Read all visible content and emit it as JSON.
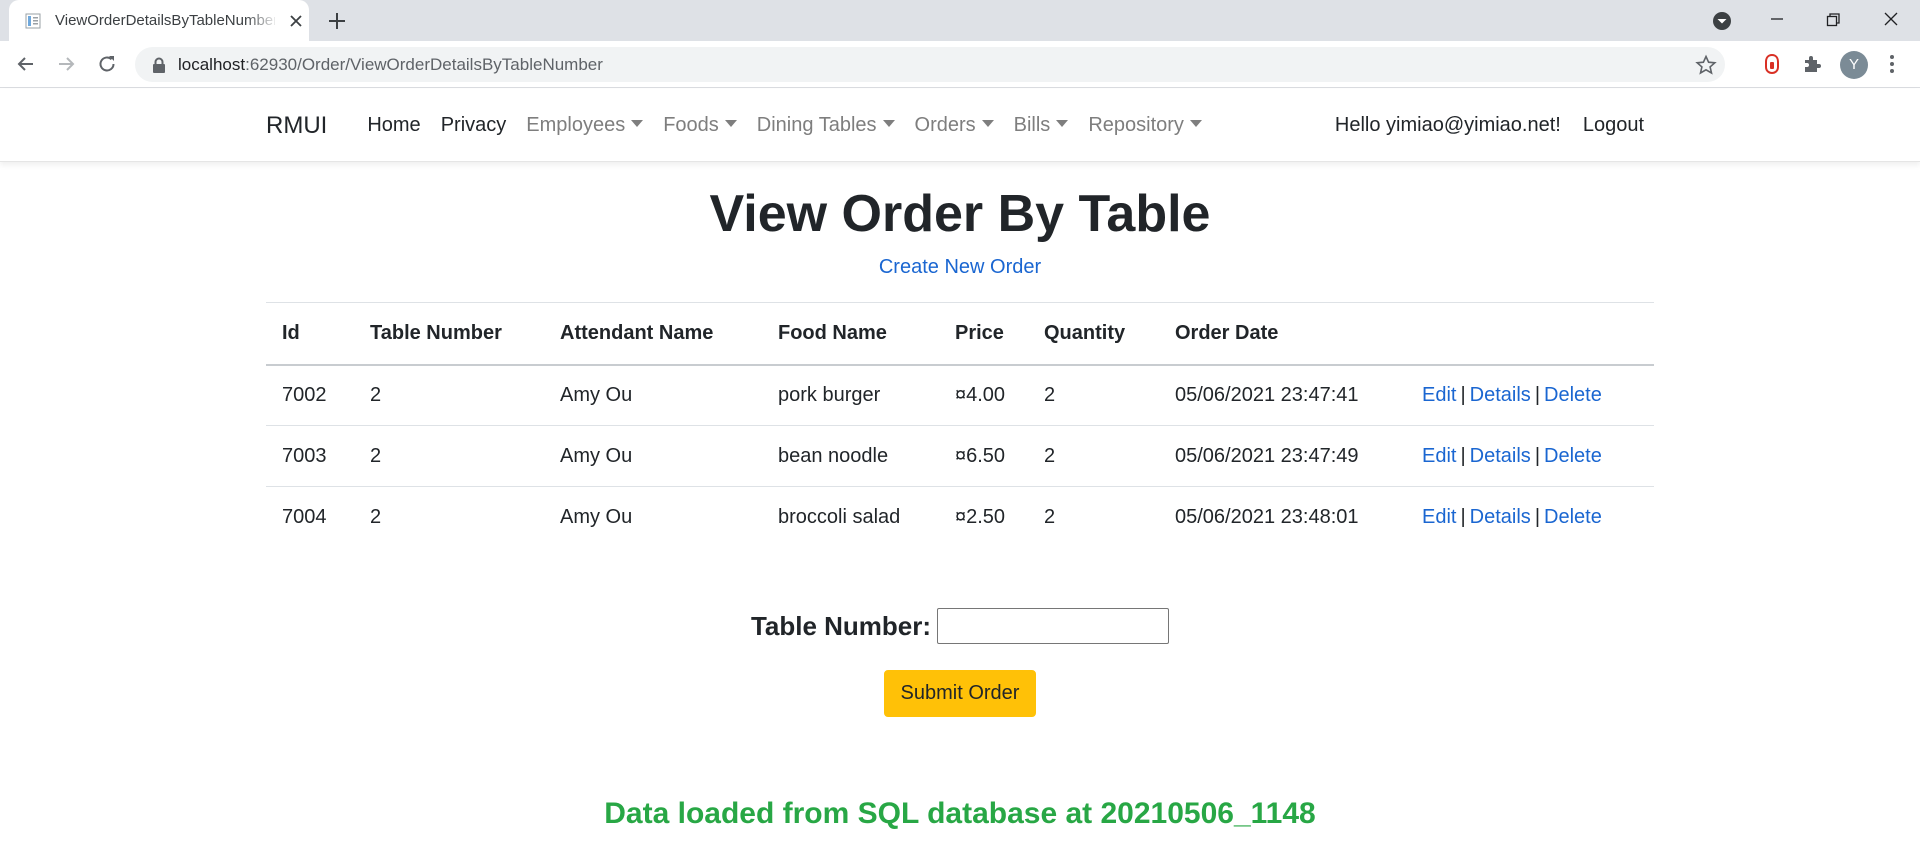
{
  "browser": {
    "tab_title": "ViewOrderDetailsByTableNumber",
    "url_host": "localhost",
    "url_path": ":62930/Order/ViewOrderDetailsByTableNumber",
    "profile_initial": "Y"
  },
  "navbar": {
    "brand": "RMUI",
    "links": [
      {
        "label": "Home",
        "dropdown": false
      },
      {
        "label": "Privacy",
        "dropdown": false
      },
      {
        "label": "Employees",
        "dropdown": true
      },
      {
        "label": "Foods",
        "dropdown": true
      },
      {
        "label": "Dining Tables",
        "dropdown": true
      },
      {
        "label": "Orders",
        "dropdown": true
      },
      {
        "label": "Bills",
        "dropdown": true
      },
      {
        "label": "Repository",
        "dropdown": true
      }
    ],
    "greeting": "Hello yimiao@yimiao.net!",
    "logout": "Logout"
  },
  "main": {
    "title": "View Order By Table",
    "create_link": "Create New Order",
    "table": {
      "headers": [
        "Id",
        "Table Number",
        "Attendant Name",
        "Food Name",
        "Price",
        "Quantity",
        "Order Date"
      ],
      "rows": [
        {
          "id": "7002",
          "table_number": "2",
          "attendant": "Amy Ou",
          "food": "pork burger",
          "price": "¤4.00",
          "quantity": "2",
          "date": "05/06/2021 23:47:41"
        },
        {
          "id": "7003",
          "table_number": "2",
          "attendant": "Amy Ou",
          "food": "bean noodle",
          "price": "¤6.50",
          "quantity": "2",
          "date": "05/06/2021 23:47:49"
        },
        {
          "id": "7004",
          "table_number": "2",
          "attendant": "Amy Ou",
          "food": "broccoli salad",
          "price": "¤2.50",
          "quantity": "2",
          "date": "05/06/2021 23:48:01"
        }
      ],
      "actions": {
        "edit": "Edit",
        "details": "Details",
        "delete": "Delete",
        "separator": "|"
      }
    },
    "form": {
      "label": "Table Number:",
      "input_value": "",
      "submit": "Submit Order"
    },
    "status": "Data loaded from SQL database at 20210506_1148"
  },
  "colors": {
    "link": "#1a66d1",
    "button": "#ffc107",
    "status": "#28a745"
  }
}
